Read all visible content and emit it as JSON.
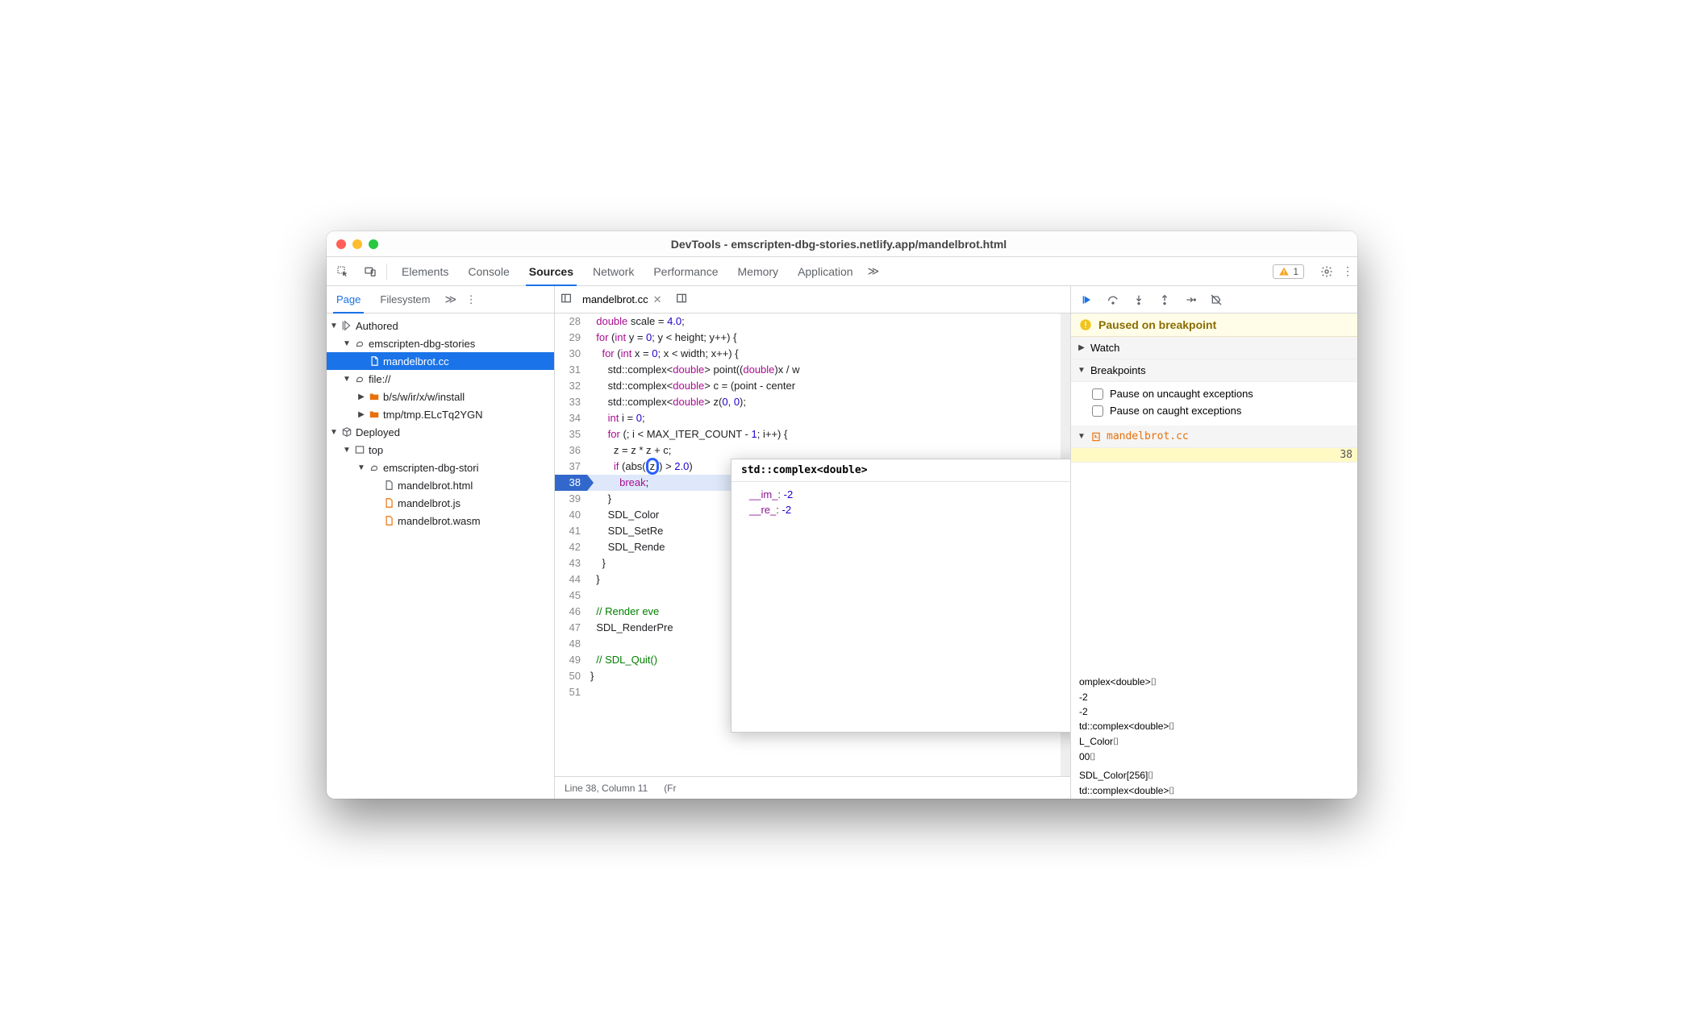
{
  "window": {
    "title": "DevTools - emscripten-dbg-stories.netlify.app/mandelbrot.html"
  },
  "main_tabs": {
    "elements": "Elements",
    "console": "Console",
    "sources": "Sources",
    "network": "Network",
    "performance": "Performance",
    "memory": "Memory",
    "application": "Application",
    "more": "≫"
  },
  "warning_count": "1",
  "left_nav": {
    "page": "Page",
    "filesystem": "Filesystem",
    "more": "≫"
  },
  "tree": {
    "authored": "Authored",
    "origin1": "emscripten-dbg-stories",
    "file_cc": "mandelbrot.cc",
    "file_proto": "file://",
    "folder_install": "b/s/w/ir/x/w/install",
    "folder_tmp": "tmp/tmp.ELcTq2YGN",
    "deployed": "Deployed",
    "top": "top",
    "origin2": "emscripten-dbg-stori",
    "file_html": "mandelbrot.html",
    "file_js": "mandelbrot.js",
    "file_wasm": "mandelbrot.wasm"
  },
  "editor": {
    "filename": "mandelbrot.cc",
    "status_line": "Line 38, Column 11",
    "status_fr": "(Fr",
    "lines_start": 28
  },
  "popover": {
    "type": "std::complex<double>",
    "rows": [
      {
        "k": "__im_",
        "v": "-2"
      },
      {
        "k": "__re_",
        "v": "-2"
      }
    ]
  },
  "debugger": {
    "paused": "Paused on breakpoint",
    "watch": "Watch",
    "breakpoints": "Breakpoints",
    "pause_uncaught": "Pause on uncaught exceptions",
    "pause_caught": "Pause on caught exceptions",
    "bp_file": "mandelbrot.cc",
    "bp_line": "38"
  },
  "scope_tail": [
    "omplex<double>⌷",
    "-2",
    "-2",
    "td::complex<double>⌷",
    "L_Color⌷",
    "00⌷",
    "",
    "SDL_Color[256]⌷",
    "td::complex<double>⌷"
  ]
}
